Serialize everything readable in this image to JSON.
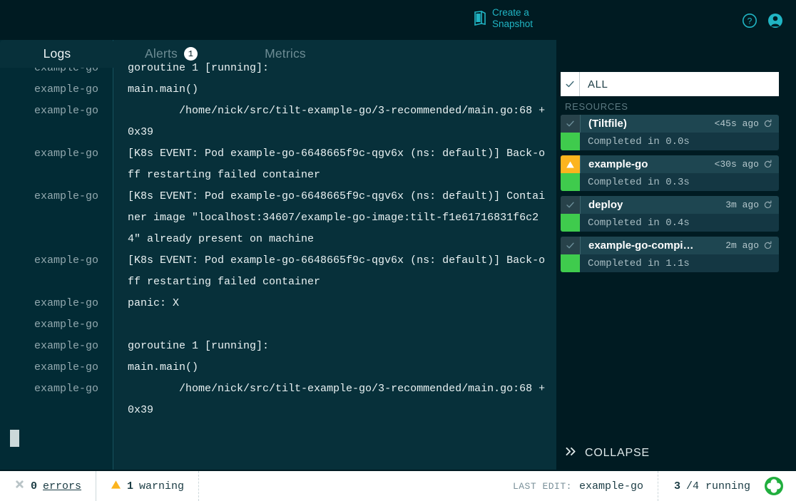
{
  "header": {
    "snapshot_label": "Create a Snapshot",
    "snapshot_icon": "snapshot-icon",
    "help_icon": "help-icon",
    "account_icon": "account-icon"
  },
  "tabs": [
    {
      "label": "Logs",
      "badge": null,
      "active": true
    },
    {
      "label": "Alerts",
      "badge": "1",
      "active": false
    },
    {
      "label": "Metrics",
      "badge": null,
      "active": false
    }
  ],
  "log": {
    "lines": [
      {
        "name": "example-go",
        "text": "goroutine 1 [running]:"
      },
      {
        "name": "example-go",
        "text": "main.main()"
      },
      {
        "name": "example-go",
        "text": "        /home/nick/src/tilt-example-go/3-recommended/main.go:68 +0x39"
      },
      {
        "name": "example-go",
        "text": "[K8s EVENT: Pod example-go-6648665f9c-qgv6x (ns: default)] Back-off restarting failed container"
      },
      {
        "name": "example-go",
        "text": "[K8s EVENT: Pod example-go-6648665f9c-qgv6x (ns: default)] Container image \"localhost:34607/example-go-image:tilt-f1e61716831f6c24\" already present on machine"
      },
      {
        "name": "example-go",
        "text": "[K8s EVENT: Pod example-go-6648665f9c-qgv6x (ns: default)] Back-off restarting failed container"
      },
      {
        "name": "example-go",
        "text": "panic: X"
      },
      {
        "name": "example-go",
        "text": ""
      },
      {
        "name": "example-go",
        "text": "goroutine 1 [running]:"
      },
      {
        "name": "example-go",
        "text": "main.main()"
      },
      {
        "name": "example-go",
        "text": "        /home/nick/src/tilt-example-go/3-recommended/main.go:68 +0x39"
      }
    ]
  },
  "sidebar": {
    "all": {
      "label": "ALL",
      "check_icon": "check-icon"
    },
    "resources_header": "RESOURCES",
    "resources": [
      {
        "name": "(Tiltfile)",
        "time": "<45s ago",
        "status": "ok",
        "status_icon": "check-icon",
        "build_msg": "Completed in 0.0s",
        "refresh_icon": "refresh-icon"
      },
      {
        "name": "example-go",
        "time": "<30s ago",
        "status": "warning",
        "status_icon": "warning-triangle-icon",
        "build_msg": "Completed in 0.3s",
        "refresh_icon": "refresh-icon"
      },
      {
        "name": "deploy",
        "time": "3m ago",
        "status": "ok",
        "status_icon": "check-icon",
        "build_msg": "Completed in 0.4s",
        "refresh_icon": "refresh-icon"
      },
      {
        "name": "example-go-compi…",
        "time": "2m ago",
        "status": "ok",
        "status_icon": "check-icon",
        "build_msg": "Completed in 1.1s",
        "refresh_icon": "refresh-icon"
      }
    ],
    "collapse_label": "COLLAPSE",
    "collapse_icon": "chevron-double-right-icon"
  },
  "statusbar": {
    "error_icon": "error-x-icon",
    "error_count": "0",
    "error_label": "errors",
    "warning_icon": "warning-triangle-icon",
    "warning_count": "1",
    "warning_label": "warning",
    "last_edit_label": "LAST EDIT:",
    "last_edit_value": "example-go",
    "running_count": "3",
    "running_total": "/4 running",
    "logo_icon": "tilt-logo-icon"
  },
  "colors": {
    "background": "#001b22",
    "log_background": "#07303a",
    "gutter": "#022b35",
    "accent_teal": "#20b5c4",
    "status_ok_green": "#3fcb4d",
    "status_warning_orange": "#fcb41e",
    "statusbar_background": "#ffffff"
  }
}
